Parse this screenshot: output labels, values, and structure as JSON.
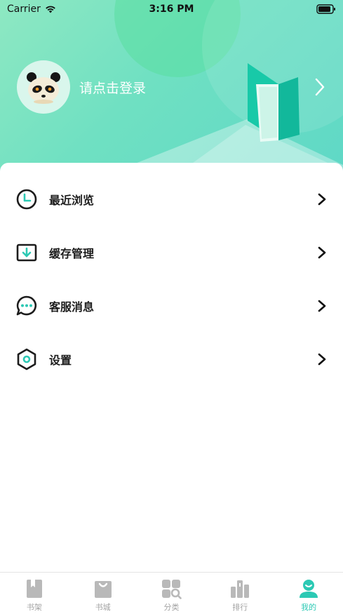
{
  "status_bar": {
    "carrier": "Carrier",
    "time": "3:16 PM"
  },
  "header": {
    "login_prompt": "请点击登录",
    "avatar_icon": "panda-avatar-icon",
    "chevron_icon": "chevron-right-icon"
  },
  "menu": {
    "items": [
      {
        "label": "最近浏览",
        "icon": "clock-icon"
      },
      {
        "label": "缓存管理",
        "icon": "download-icon"
      },
      {
        "label": "客服消息",
        "icon": "chat-bubble-icon"
      },
      {
        "label": "设置",
        "icon": "hexagon-settings-icon"
      }
    ]
  },
  "tabbar": {
    "tabs": [
      {
        "label": "书架",
        "icon": "bookshelf-icon",
        "active": false
      },
      {
        "label": "书城",
        "icon": "bag-icon",
        "active": false
      },
      {
        "label": "分类",
        "icon": "category-icon",
        "active": false
      },
      {
        "label": "排行",
        "icon": "ranking-icon",
        "active": false
      },
      {
        "label": "我的",
        "icon": "profile-icon",
        "active": true
      }
    ]
  },
  "colors": {
    "accent": "#2cc9b4",
    "header_start": "#8ee8c2",
    "header_end": "#5fd8c6",
    "inactive_tab": "#a3a3a3"
  }
}
